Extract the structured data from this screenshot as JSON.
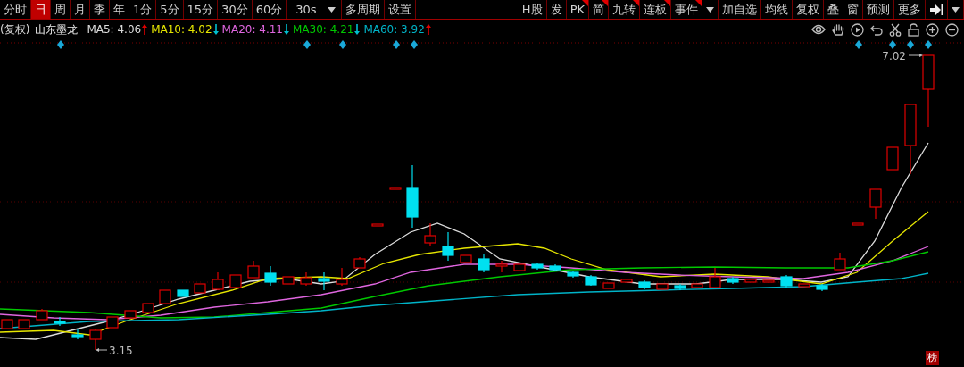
{
  "toolbar": {
    "periods": [
      {
        "label": "分时",
        "selected": false
      },
      {
        "label": "日",
        "selected": true
      },
      {
        "label": "周",
        "selected": false
      },
      {
        "label": "月",
        "selected": false
      },
      {
        "label": "季",
        "selected": false
      },
      {
        "label": "年",
        "selected": false
      },
      {
        "label": "1分",
        "selected": false
      },
      {
        "label": "5分",
        "selected": false
      },
      {
        "label": "15分",
        "selected": false
      },
      {
        "label": "30分",
        "selected": false
      },
      {
        "label": "60分",
        "selected": false
      }
    ],
    "interval": "30s",
    "more_periods": "多周期",
    "settings": "设置",
    "tools": [
      {
        "label": "H股",
        "flag": false
      },
      {
        "label": "发",
        "flag": false
      },
      {
        "label": "PK",
        "flag": true
      },
      {
        "label": "简",
        "flag": true
      },
      {
        "label": "九转",
        "flag": true
      },
      {
        "label": "连板",
        "flag": true
      },
      {
        "label": "事件",
        "flag": true
      }
    ],
    "actions": [
      "加自选",
      "均线",
      "复权",
      "叠",
      "窗",
      "预测",
      "更多"
    ]
  },
  "legend": {
    "prefix": "(复权)",
    "stock": "山东墨龙",
    "averages": [
      {
        "label": "MA5: 4.06",
        "color": "#dcdcdc",
        "rising": true
      },
      {
        "label": "MA10: 4.02",
        "color": "#e6e600",
        "rising": false
      },
      {
        "label": "MA20: 4.11",
        "color": "#e066e0",
        "rising": false
      },
      {
        "label": "MA30: 4.21",
        "color": "#00c800",
        "rising": false
      },
      {
        "label": "MA60: 3.92",
        "color": "#00b4c8",
        "rising": true
      }
    ]
  },
  "chart": {
    "high_label": "7.02",
    "low_label": "3.15"
  },
  "badge": "榜"
}
